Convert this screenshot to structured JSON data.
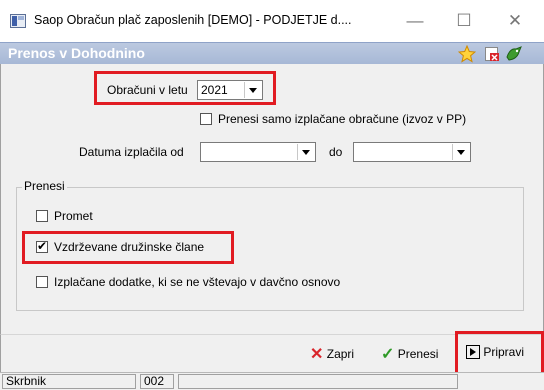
{
  "window": {
    "title": "Saop Obračun plač zaposlenih [DEMO] - PODJETJE d....",
    "minimize": "—",
    "maximize": "☐",
    "close": "✕"
  },
  "header": {
    "title": "Prenos v Dohodnino",
    "icons": [
      "star-icon",
      "delete-icon",
      "help-icon"
    ]
  },
  "form": {
    "year_label": "Obračuni v letu",
    "year_value": "2021",
    "paid_only_label": "Prenesi samo izplačane obračune (izvoz v PP)",
    "paid_only_checked": false,
    "date_from_label": "Datuma izplačila od",
    "date_from_value": "",
    "date_to_label": "do",
    "date_to_value": ""
  },
  "transfer_group": {
    "title": "Prenesi",
    "items": [
      {
        "label": "Promet",
        "checked": false
      },
      {
        "label": "Vzdrževane družinske člane",
        "checked": true
      },
      {
        "label": "Izplačane dodatke, ki se ne vštevajo v davčno osnovo",
        "checked": false
      }
    ]
  },
  "buttons": {
    "close_label": "Zapri",
    "transfer_label": "Prenesi",
    "prepare_label": "Pripravi"
  },
  "statusbar": {
    "user": "Skrbnik",
    "code": "002"
  },
  "colors": {
    "highlight": "#e11b22",
    "header_bg": "#a7b8d6"
  }
}
